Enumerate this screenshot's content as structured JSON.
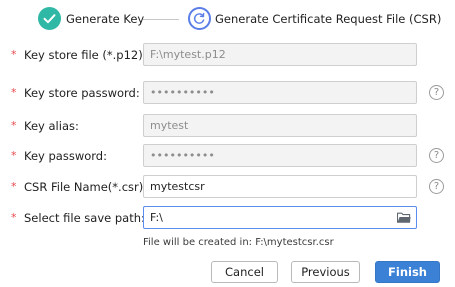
{
  "stepper": {
    "step1_label": "Generate Key",
    "step2_label": "Generate Certificate Request File (CSR)",
    "step1_status": "completed",
    "step2_status": "active"
  },
  "form": {
    "required_mark": "*",
    "key_store_file": {
      "label": "Key store file (*.p12):",
      "value": "F:\\mytest.p12"
    },
    "key_store_password": {
      "label": "Key store password:",
      "value": "••••••••••"
    },
    "key_alias": {
      "label": "Key alias:",
      "value": "mytest"
    },
    "key_password": {
      "label": "Key password:",
      "value": "••••••••••"
    },
    "csr_file_name": {
      "label": "CSR File Name(*.csr):",
      "value": "mytestcsr"
    },
    "save_path": {
      "label": "Select file save path:",
      "value": "F:\\"
    },
    "help_glyph": "?",
    "hint": "File will be created in: F:\\mytestcsr.csr"
  },
  "buttons": {
    "cancel": "Cancel",
    "previous": "Previous",
    "finish": "Finish"
  },
  "colors": {
    "completed_step": "#2fb8a6",
    "active_step": "#5a7de8",
    "required": "#e5484d",
    "primary_button": "#3b82d6"
  },
  "icons": {
    "step1": "check-icon",
    "step2": "refresh-icon",
    "help": "help-icon",
    "browse": "folder-icon"
  }
}
